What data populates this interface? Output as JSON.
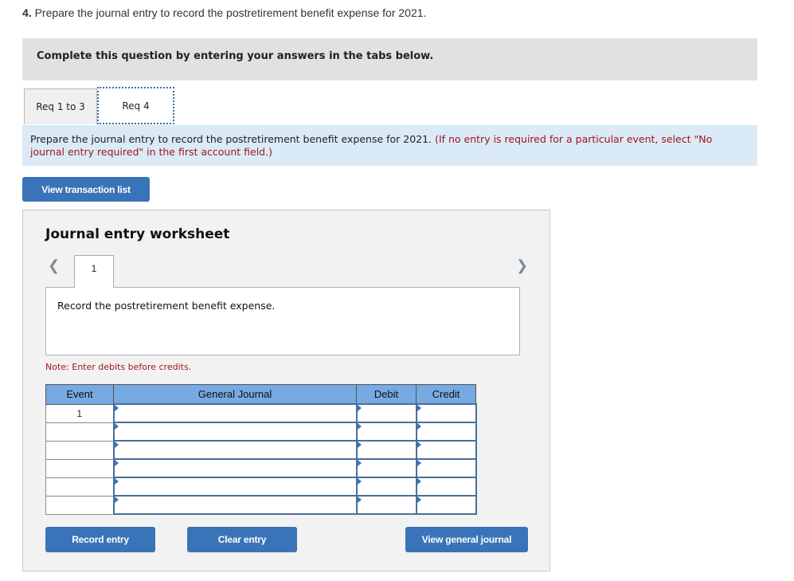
{
  "question": {
    "number": "4.",
    "text": "Prepare the journal entry to record the postretirement benefit expense for 2021."
  },
  "banner": "Complete this question by entering your answers in the tabs below.",
  "tabs": [
    {
      "label": "Req 1 to 3",
      "active": false
    },
    {
      "label": "Req 4",
      "active": true
    }
  ],
  "instruction": {
    "main": "Prepare the journal entry to record the postretirement benefit expense for 2021.",
    "note": "(If no entry is required for a particular event, select \"No journal entry required\" in the first account field.)"
  },
  "view_transaction_list_label": "View transaction list",
  "worksheet": {
    "title": "Journal entry worksheet",
    "prev_icon": "chevron-left-icon",
    "next_icon": "chevron-right-icon",
    "page_tab": "1",
    "description": "Record the postretirement benefit expense.",
    "note": "Note: Enter debits before credits.",
    "columns": [
      "Event",
      "General Journal",
      "Debit",
      "Credit"
    ],
    "rows": [
      {
        "event": "1",
        "account": "",
        "debit": "",
        "credit": ""
      },
      {
        "event": "",
        "account": "",
        "debit": "",
        "credit": ""
      },
      {
        "event": "",
        "account": "",
        "debit": "",
        "credit": ""
      },
      {
        "event": "",
        "account": "",
        "debit": "",
        "credit": ""
      },
      {
        "event": "",
        "account": "",
        "debit": "",
        "credit": ""
      },
      {
        "event": "",
        "account": "",
        "debit": "",
        "credit": ""
      }
    ],
    "buttons": {
      "record": "Record entry",
      "clear": "Clear entry",
      "view_journal": "View general journal"
    }
  },
  "colors": {
    "button": "#3a74b8",
    "header": "#77a9e2",
    "instruction_bg": "#daeaf7",
    "note_red": "#a3141c"
  }
}
